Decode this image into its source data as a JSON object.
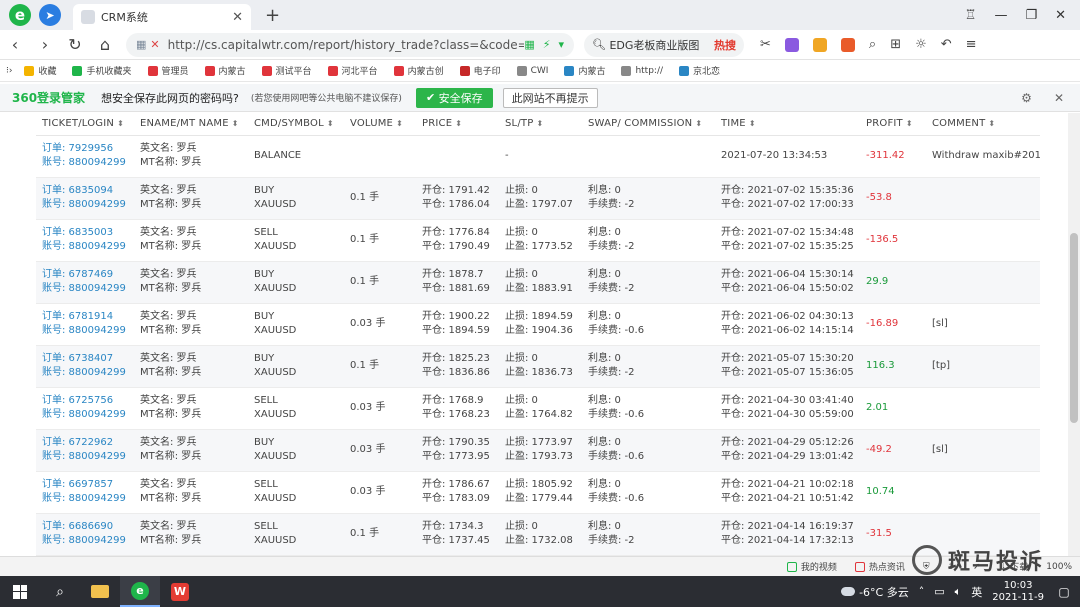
{
  "browser": {
    "tab_title": "CRM系统",
    "url": "http://cs.capitalwtr.com/report/history_trade?class=&code=&LC",
    "search_text": "EDG老板商业版图",
    "search_hot": "热搜",
    "bookmarks": [
      "收藏",
      "手机收藏夹",
      "管理员",
      "内蒙古",
      "测试平台",
      "河北平台",
      "内蒙古创",
      "电子印",
      "CWI",
      "内蒙古",
      "http://",
      "京北恋"
    ],
    "password_bar": {
      "brand": "360登录管家",
      "question": "想安全保存此网页的密码吗?",
      "note": "(若您使用网吧等公共电脑不建议保存)",
      "save_label": "安全保存",
      "never_label": "此网站不再提示"
    }
  },
  "table": {
    "headers": [
      "TICKET/LOGIN",
      "ENAME/MT NAME",
      "CMD/SYMBOL",
      "VOLUME",
      "PRICE",
      "SL/TP",
      "SWAP/ COMMISSION",
      "TIME",
      "PROFIT",
      "COMMENT"
    ],
    "rows": [
      {
        "ticket": "订单: 7929956",
        "login": "账号: 880094299",
        "ename": "英文名: 罗兵",
        "mtname": "MT名称: 罗兵",
        "cmd": "BALANCE",
        "symbol": "",
        "volume": "",
        "price_open": "",
        "price_close": "",
        "sl": "-",
        "tp": "",
        "swap": "",
        "commission": "",
        "time_open": "2021-07-20 13:34:53",
        "time_close": "",
        "profit": "-311.42",
        "profit_sign": "neg",
        "comment": "Withdraw maxib#201"
      },
      {
        "ticket": "订单: 6835094",
        "login": "账号: 880094299",
        "ename": "英文名: 罗兵",
        "mtname": "MT名称: 罗兵",
        "cmd": "BUY",
        "symbol": "XAUUSD",
        "volume": "0.1 手",
        "price_open": "开仓: 1791.42",
        "price_close": "平仓: 1786.04",
        "sl": "止损: 0",
        "tp": "止盈: 1797.07",
        "swap": "利息: 0",
        "commission": "手续费: -2",
        "time_open": "开仓: 2021-07-02 15:35:36",
        "time_close": "平仓: 2021-07-02 17:00:33",
        "profit": "-53.8",
        "profit_sign": "neg",
        "comment": ""
      },
      {
        "ticket": "订单: 6835003",
        "login": "账号: 880094299",
        "ename": "英文名: 罗兵",
        "mtname": "MT名称: 罗兵",
        "cmd": "SELL",
        "symbol": "XAUUSD",
        "volume": "0.1 手",
        "price_open": "开仓: 1776.84",
        "price_close": "平仓: 1790.49",
        "sl": "止损: 0",
        "tp": "止盈: 1773.52",
        "swap": "利息: 0",
        "commission": "手续费: -2",
        "time_open": "开仓: 2021-07-02 15:34:48",
        "time_close": "平仓: 2021-07-02 15:35:25",
        "profit": "-136.5",
        "profit_sign": "neg",
        "comment": ""
      },
      {
        "ticket": "订单: 6787469",
        "login": "账号: 880094299",
        "ename": "英文名: 罗兵",
        "mtname": "MT名称: 罗兵",
        "cmd": "BUY",
        "symbol": "XAUUSD",
        "volume": "0.1 手",
        "price_open": "开仓: 1878.7",
        "price_close": "平仓: 1881.69",
        "sl": "止损: 0",
        "tp": "止盈: 1883.91",
        "swap": "利息: 0",
        "commission": "手续费: -2",
        "time_open": "开仓: 2021-06-04 15:30:14",
        "time_close": "平仓: 2021-06-04 15:50:02",
        "profit": "29.9",
        "profit_sign": "pos",
        "comment": ""
      },
      {
        "ticket": "订单: 6781914",
        "login": "账号: 880094299",
        "ename": "英文名: 罗兵",
        "mtname": "MT名称: 罗兵",
        "cmd": "BUY",
        "symbol": "XAUUSD",
        "volume": "0.03 手",
        "price_open": "开仓: 1900.22",
        "price_close": "平仓: 1894.59",
        "sl": "止损: 1894.59",
        "tp": "止盈: 1904.36",
        "swap": "利息: 0",
        "commission": "手续费: -0.6",
        "time_open": "开仓: 2021-06-02 04:30:13",
        "time_close": "平仓: 2021-06-02 14:15:14",
        "profit": "-16.89",
        "profit_sign": "neg",
        "comment": "[sl]"
      },
      {
        "ticket": "订单: 6738407",
        "login": "账号: 880094299",
        "ename": "英文名: 罗兵",
        "mtname": "MT名称: 罗兵",
        "cmd": "BUY",
        "symbol": "XAUUSD",
        "volume": "0.1 手",
        "price_open": "开仓: 1825.23",
        "price_close": "平仓: 1836.86",
        "sl": "止损: 0",
        "tp": "止盈: 1836.73",
        "swap": "利息: 0",
        "commission": "手续费: -2",
        "time_open": "开仓: 2021-05-07 15:30:20",
        "time_close": "平仓: 2021-05-07 15:36:05",
        "profit": "116.3",
        "profit_sign": "pos",
        "comment": "[tp]"
      },
      {
        "ticket": "订单: 6725756",
        "login": "账号: 880094299",
        "ename": "英文名: 罗兵",
        "mtname": "MT名称: 罗兵",
        "cmd": "SELL",
        "symbol": "XAUUSD",
        "volume": "0.03 手",
        "price_open": "开仓: 1768.9",
        "price_close": "平仓: 1768.23",
        "sl": "止损: 0",
        "tp": "止盈: 1764.82",
        "swap": "利息: 0",
        "commission": "手续费: -0.6",
        "time_open": "开仓: 2021-04-30 03:41:40",
        "time_close": "平仓: 2021-04-30 05:59:00",
        "profit": "2.01",
        "profit_sign": "pos",
        "comment": ""
      },
      {
        "ticket": "订单: 6722962",
        "login": "账号: 880094299",
        "ename": "英文名: 罗兵",
        "mtname": "MT名称: 罗兵",
        "cmd": "BUY",
        "symbol": "XAUUSD",
        "volume": "0.03 手",
        "price_open": "开仓: 1790.35",
        "price_close": "平仓: 1773.95",
        "sl": "止损: 1773.97",
        "tp": "止盈: 1793.73",
        "swap": "利息: 0",
        "commission": "手续费: -0.6",
        "time_open": "开仓: 2021-04-29 05:12:26",
        "time_close": "平仓: 2021-04-29 13:01:42",
        "profit": "-49.2",
        "profit_sign": "neg",
        "comment": "[sl]"
      },
      {
        "ticket": "订单: 6697857",
        "login": "账号: 880094299",
        "ename": "英文名: 罗兵",
        "mtname": "MT名称: 罗兵",
        "cmd": "SELL",
        "symbol": "XAUUSD",
        "volume": "0.03 手",
        "price_open": "开仓: 1786.67",
        "price_close": "平仓: 1783.09",
        "sl": "止损: 1805.92",
        "tp": "止盈: 1779.44",
        "swap": "利息: 0",
        "commission": "手续费: -0.6",
        "time_open": "开仓: 2021-04-21 10:02:18",
        "time_close": "平仓: 2021-04-21 10:51:42",
        "profit": "10.74",
        "profit_sign": "pos",
        "comment": ""
      },
      {
        "ticket": "订单: 6686690",
        "login": "账号: 880094299",
        "ename": "英文名: 罗兵",
        "mtname": "MT名称: 罗兵",
        "cmd": "SELL",
        "symbol": "XAUUSD",
        "volume": "0.1 手",
        "price_open": "开仓: 1734.3",
        "price_close": "平仓: 1737.45",
        "sl": "止损: 0",
        "tp": "止盈: 1732.08",
        "swap": "利息: 0",
        "commission": "手续费: -2",
        "time_open": "开仓: 2021-04-14 16:19:37",
        "time_close": "平仓: 2021-04-14 17:32:13",
        "profit": "-31.5",
        "profit_sign": "neg",
        "comment": ""
      }
    ]
  },
  "statusbar": {
    "items": [
      "我的视频",
      "热点资讯",
      "下载",
      "100%"
    ]
  },
  "taskbar": {
    "weather": "-6°C 多云",
    "ime": "英",
    "time": "10:03",
    "date": "2021-11-9"
  },
  "watermark": "斑马投诉",
  "colors": {
    "link": "#2a86c4",
    "profit_positive": "#1a9a3a",
    "profit_negative": "#e0343b",
    "brand_green": "#1fb54a"
  }
}
